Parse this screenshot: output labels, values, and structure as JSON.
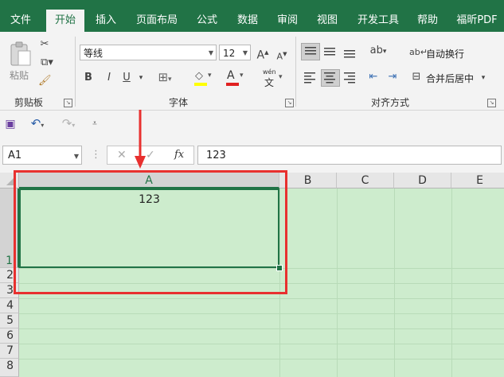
{
  "ribbon_tabs": [
    "文件",
    "开始",
    "插入",
    "页面布局",
    "公式",
    "数据",
    "审阅",
    "视图",
    "开发工具",
    "帮助",
    "福昕PDF"
  ],
  "clipboard": {
    "paste_label": "粘贴",
    "group_label": "剪贴板"
  },
  "font": {
    "name": "等线",
    "size": "12",
    "group_label": "字体",
    "bold": "B",
    "italic": "I",
    "underline": "U",
    "grow": "A",
    "shrink": "A",
    "wen": "wén",
    "wen_char": "文"
  },
  "alignment": {
    "wrap_label": "自动换行",
    "merge_label": "合并后居中",
    "group_label": "对齐方式"
  },
  "formula_bar": {
    "name_box": "A1",
    "fx": "fx",
    "value": "123"
  },
  "grid": {
    "columns": [
      "A",
      "B",
      "C",
      "D",
      "E"
    ],
    "rows": [
      "1",
      "2",
      "3",
      "4",
      "5",
      "6",
      "7",
      "8"
    ],
    "cell_a1": "123"
  },
  "colors": {
    "ribbon_green": "#217346",
    "sheet_fill": "#cdeccd",
    "annotation_red": "#e8302f"
  }
}
